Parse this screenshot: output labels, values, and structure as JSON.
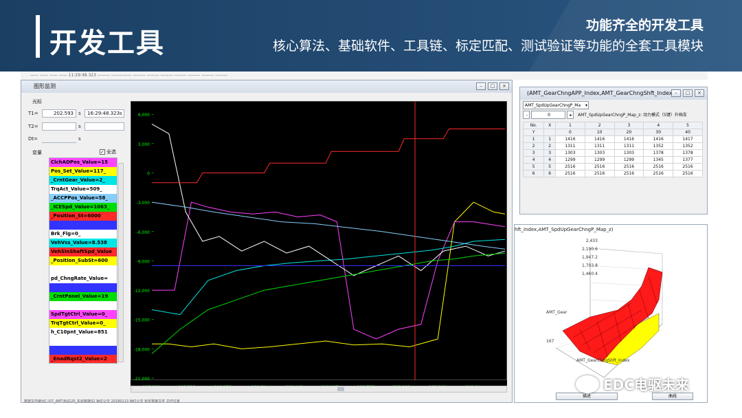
{
  "banner": {
    "title": "开发工具",
    "subtitle": "功能齐全的开发工具",
    "tagline": "核心算法、基础软件、工具链、标定匹配、测试验证等功能的全套工具模块"
  },
  "wave_window": {
    "title": "图形监测",
    "cursor_group": "光标",
    "t1_label": "T1=",
    "t1_value": "202.593",
    "t1_unit": "s",
    "t1_clock": "16:29:48.323s",
    "t2_label": "T2=",
    "t2_unit": "s",
    "dt_label": "Dt=",
    "dt_unit": "s",
    "var_label": "变量",
    "select_all": "全选",
    "variables": [
      {
        "label": "ClchADPos_Value=15",
        "color": "#ff44ff"
      },
      {
        "label": "Pos_Set_Value=117_",
        "color": "#ffff00"
      },
      {
        "label": "_CrntGear_Value=2_",
        "color": "#00e6e6"
      },
      {
        "label": "TrqAct_Value=509_",
        "color": "#ffffff"
      },
      {
        "label": "_ACCPPos_Value=58_",
        "color": "#87cefa"
      },
      {
        "label": "_ICESpd_Value=1063_",
        "color": "#00dd00"
      },
      {
        "label": "_Position_St=6000",
        "color": "#ff2a2a"
      },
      {
        "label": "",
        "color": "#3333ff"
      },
      {
        "label": "Brk_Flg=0_",
        "color": "#ffffff"
      },
      {
        "label": "VehVss_Value=8.538",
        "color": "#00e6e6"
      },
      {
        "label": "VehSInShaftSpd_Value",
        "color": "#ff2a2a"
      },
      {
        "label": "_Position_SubSt=600",
        "color": "#ffff00"
      },
      {
        "label": "",
        "color": "#ffffff"
      },
      {
        "label": "pd_ChngRate_Value=",
        "color": "#ffffff"
      },
      {
        "label": "",
        "color": "#3333ff"
      },
      {
        "label": "_CrntPanel_Value=19",
        "color": "#00dd00"
      },
      {
        "label": "",
        "color": "#ffffff"
      },
      {
        "label": "SpdTgtCtrl_Value=0_",
        "color": "#ff44ff"
      },
      {
        "label": "TrqTgtCtrl_Value=0_",
        "color": "#ffff00"
      },
      {
        "label": "h_C10pnt_Value=851",
        "color": "#ffffff"
      },
      {
        "label": "",
        "color": "#ffffff"
      },
      {
        "label": "",
        "color": "#3333ff"
      },
      {
        "label": "_EnadRqst2_Value=2",
        "color": "#ff2a2a"
      }
    ],
    "status_text": "数据文件路径C:\\07_AMT测试\\20_实验数据02 相位公交 20180113 相位公交 标定数据文件 文件位置"
  },
  "chart_data": {
    "type": "line",
    "title": "",
    "xlabel": "",
    "ylabel": "",
    "xlim": [
      197.895,
      204.2
    ],
    "ylim": [
      -21000,
      7000
    ],
    "x_ticks": [
      "197.895",
      "198.533",
      "199.172",
      "199.81",
      "200.448",
      "201.087",
      "201.725",
      "202.363",
      "203.002",
      "203.64"
    ],
    "y_ticks": [
      "6,000",
      "3,000",
      "0",
      "-3,000",
      "-6,000",
      "-9,000",
      "-12,000",
      "-15,000",
      "-18,000",
      "-21,000"
    ],
    "cursor_x": 202.593,
    "background": "#000000",
    "grid": false,
    "series": [
      {
        "color": "#ffff00",
        "x": [
          197.895,
          198.2,
          198.6,
          199.0,
          199.5,
          200.0,
          200.5,
          201.0,
          201.5,
          202.0,
          202.5,
          203.0,
          203.3,
          203.64,
          204.0,
          204.2
        ],
        "y": [
          -17500,
          -17500,
          -17800,
          -17500,
          -18000,
          -17800,
          -17500,
          -17200,
          -17600,
          -17500,
          -17800,
          -17000,
          -5000,
          -3000,
          -4000,
          -4200
        ]
      },
      {
        "color": "#ff44ff",
        "x": [
          197.895,
          198.3,
          198.6,
          198.9,
          199.3,
          199.7,
          200.1,
          200.5,
          200.9,
          201.2,
          201.5,
          201.9,
          202.3,
          202.7,
          203.0,
          203.3,
          203.64,
          204.2
        ],
        "y": [
          -12000,
          -12000,
          -3000,
          -3500,
          -4000,
          -4200,
          -4000,
          -4500,
          -4300,
          -5000,
          -16000,
          -17000,
          -16000,
          -15500,
          -9000,
          -5000,
          -5000,
          -5500
        ]
      },
      {
        "color": "#00e6e6",
        "x": [
          197.895,
          198.4,
          198.9,
          199.4,
          199.9,
          200.4,
          200.9,
          201.4,
          201.9,
          202.4,
          202.9,
          203.3,
          203.64,
          204.2
        ],
        "y": [
          -14000,
          -14500,
          -11000,
          -10000,
          -9500,
          -9200,
          -9000,
          -8800,
          -8500,
          -8200,
          -7900,
          -7500,
          -7000,
          -6800
        ]
      },
      {
        "color": "#ffffff",
        "x": [
          197.895,
          198.2,
          198.5,
          198.8,
          199.1,
          199.5,
          199.9,
          200.3,
          200.7,
          201.1,
          201.5,
          201.9,
          202.3,
          202.7,
          203.1,
          203.5,
          203.9,
          204.2
        ],
        "y": [
          5000,
          4000,
          -4000,
          -7000,
          -6500,
          -8000,
          -7000,
          -8200,
          -7500,
          -9000,
          -10500,
          -9500,
          -8500,
          -10000,
          -8000,
          -7500,
          -8500,
          -8000
        ]
      },
      {
        "color": "#00dd00",
        "x": [
          197.895,
          198.4,
          198.9,
          199.4,
          199.9,
          200.4,
          200.9,
          201.4,
          201.9,
          202.4,
          202.9,
          203.3,
          203.64,
          204.2
        ],
        "y": [
          -18500,
          -16000,
          -14000,
          -13000,
          -12000,
          -11500,
          -11000,
          -10500,
          -10000,
          -9500,
          -9000,
          -8800,
          -8500,
          -8200
        ]
      },
      {
        "color": "#ff2a2a",
        "x": [
          197.895,
          198.7,
          198.8,
          199.9,
          200.0,
          201.0,
          201.1,
          202.3,
          202.4,
          203.1,
          203.2,
          204.2
        ],
        "y": [
          -1000,
          -1000,
          0,
          0,
          1000,
          1000,
          2200,
          2200,
          3500,
          3500,
          4500,
          4500
        ]
      },
      {
        "color": "#3333ff",
        "x": [
          197.895,
          204.2
        ],
        "y": [
          -9500,
          -9500
        ]
      },
      {
        "color": "#87cefa",
        "x": [
          197.895,
          198.5,
          199.0,
          199.6,
          200.2,
          200.8,
          201.4,
          202.0,
          202.6,
          203.2,
          203.8,
          204.2
        ],
        "y": [
          -3000,
          -3500,
          -4000,
          -4500,
          -5000,
          -5200,
          -5600,
          -6000,
          -6500,
          -7000,
          -7500,
          -7800
        ]
      }
    ]
  },
  "map_window": {
    "title": "(AMT_GearChngAPP_Index,AMT_GearChngShft_Index,",
    "selector": "AMT_SpdUpGearChngP_Ma",
    "map_name": "AMT_SpdUpGearChngP_Map_z: 动力模式（5键）升档车",
    "spin_value": "0",
    "header_row1": [
      "No.",
      "X",
      "1",
      "2",
      "3",
      "4",
      "5"
    ],
    "header_row2": [
      "Y",
      "",
      "0",
      "10",
      "20",
      "30",
      "40"
    ],
    "rows": [
      [
        "1",
        "1",
        "1416",
        "1416",
        "1416",
        "1416",
        "1417"
      ],
      [
        "2",
        "2",
        "1311",
        "1311",
        "1311",
        "1352",
        "1352"
      ],
      [
        "3",
        "3",
        "1303",
        "1303",
        "1303",
        "1378",
        "1378"
      ],
      [
        "4",
        "4",
        "1299",
        "1299",
        "1299",
        "1345",
        "1377"
      ],
      [
        "5",
        "5",
        "2516",
        "2516",
        "2516",
        "2516",
        "2516"
      ],
      [
        "6",
        "6",
        "2516",
        "2516",
        "2516",
        "2516",
        "2516"
      ]
    ]
  },
  "surface_window": {
    "title": "hft_Index,AMT_SpdUpGearChngP_Map_z)",
    "z_ticks": [
      "2,433",
      "2,190.6",
      "1,947.2",
      "1,703.8",
      "1,460.4"
    ],
    "x_axis_label": "AMT_GearChngShft_Index",
    "y_axis_label": "AMT_Gear",
    "corner_label": "167",
    "btn_left": "描述",
    "btn_right": "曲线"
  },
  "watermark": {
    "text": "EDC电驱未来"
  },
  "tabstrip": {
    "text": "—— —— —— —— 11:29:48.323 ——— ————— ——— ——— ——— ——— ——— ——— ———"
  }
}
